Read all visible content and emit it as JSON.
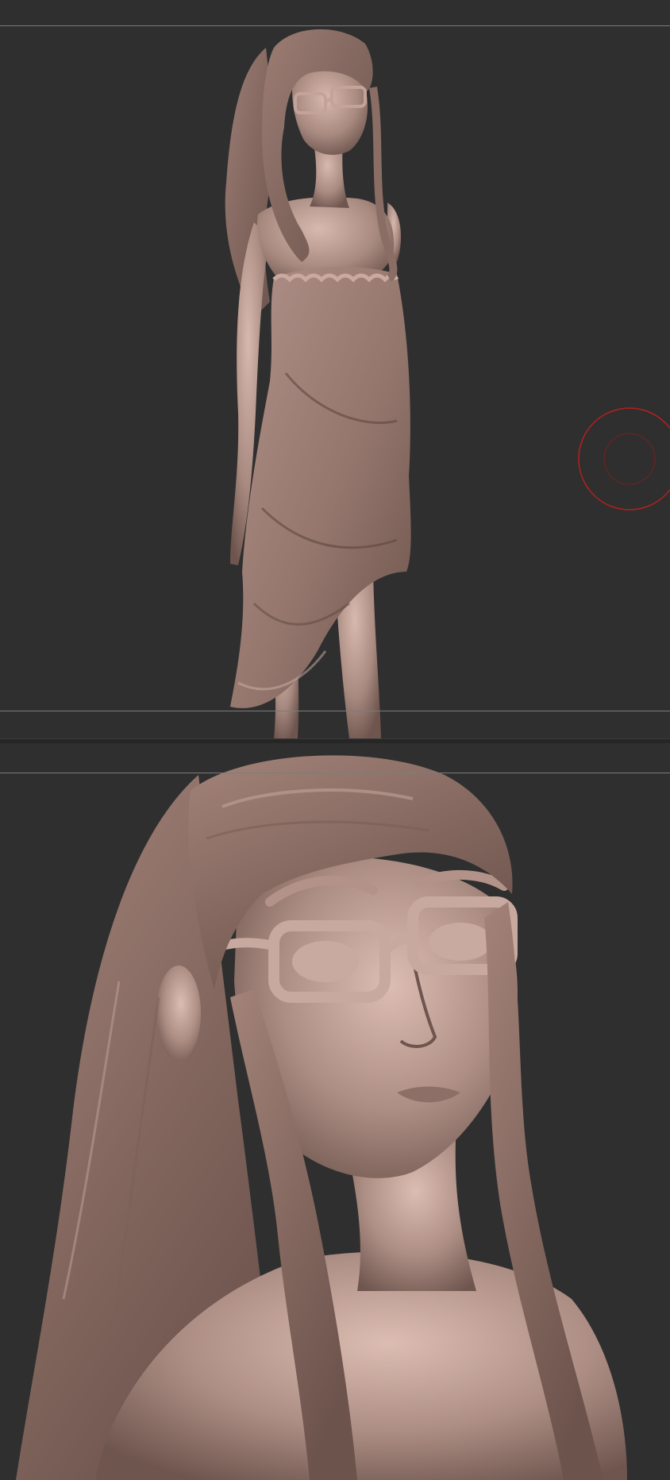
{
  "viewports": [
    {
      "view": "full-body",
      "subject": "sculpt"
    },
    {
      "view": "head-closeup",
      "subject": "sculpt"
    }
  ],
  "colors": {
    "background": "#2f2f2f",
    "clay": "#a98a82",
    "clay_light": "#d6b8ae",
    "clay_dark": "#5e4640",
    "guide_line": "#7c7c7c",
    "brush_cursor": "#b32020"
  },
  "brush_cursor": {
    "icon": "brush-cursor-icon"
  }
}
